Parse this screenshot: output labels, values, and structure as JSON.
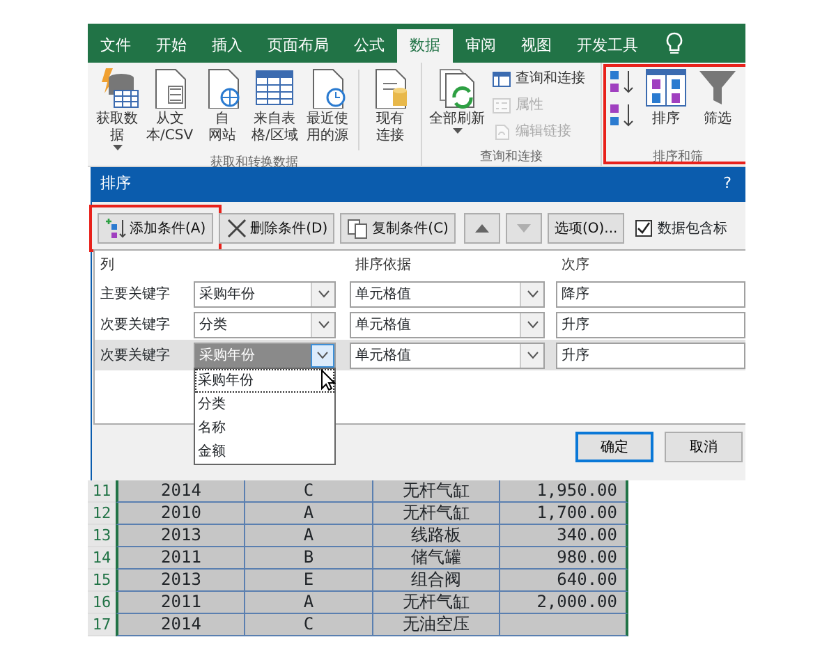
{
  "ribbon": {
    "tabs": [
      {
        "label": "文件",
        "selected": false
      },
      {
        "label": "开始",
        "selected": false
      },
      {
        "label": "插入",
        "selected": false
      },
      {
        "label": "页面布局",
        "selected": false
      },
      {
        "label": "公式",
        "selected": false
      },
      {
        "label": "数据",
        "selected": true
      },
      {
        "label": "审阅",
        "selected": false
      },
      {
        "label": "视图",
        "selected": false
      },
      {
        "label": "开发工具",
        "selected": false
      }
    ],
    "groups": [
      {
        "label": "获取和转换数据",
        "annotated": false,
        "buttons": [
          {
            "kind": "large",
            "lines": [
              "获取数",
              "据"
            ],
            "caret": true
          },
          {
            "kind": "large",
            "lines": [
              "从文",
              "本/CSV"
            ],
            "caret": false
          },
          {
            "kind": "large",
            "lines": [
              "自",
              "网站"
            ],
            "caret": false
          },
          {
            "kind": "large",
            "lines": [
              "来自表",
              "格/区域"
            ],
            "caret": false
          },
          {
            "kind": "large",
            "lines": [
              "最近使",
              "用的源"
            ],
            "caret": false
          },
          {
            "kind": "sep"
          },
          {
            "kind": "large",
            "lines": [
              "现有",
              "连接"
            ],
            "caret": false
          }
        ]
      },
      {
        "label": "查询和连接",
        "annotated": false,
        "buttons": [
          {
            "kind": "large",
            "lines": [
              "全部刷新"
            ],
            "caret": true
          },
          {
            "kind": "stack",
            "items": [
              {
                "label": "查询和连接",
                "disabled": false
              },
              {
                "label": "属性",
                "disabled": true
              },
              {
                "label": "编辑链接",
                "disabled": true
              }
            ]
          }
        ]
      },
      {
        "label": "排序和筛",
        "annotated": true,
        "buttons": [
          {
            "kind": "stack",
            "items": [
              {
                "disabled": false
              },
              {
                "disabled": false
              }
            ]
          },
          {
            "kind": "large",
            "lines": [
              "排序"
            ],
            "caret": false
          },
          {
            "kind": "large",
            "lines": [
              "筛选"
            ],
            "caret": false
          }
        ]
      }
    ]
  },
  "dialog": {
    "title": "排序",
    "help": "?",
    "toolbar": [
      {
        "kind": "add",
        "label": "添加条件(A)",
        "annotated": true,
        "disabled": false
      },
      {
        "kind": "delete",
        "label": "删除条件(D)",
        "annotated": false,
        "disabled": false
      },
      {
        "kind": "copy",
        "label": "复制条件(C)",
        "annotated": false,
        "disabled": false
      },
      {
        "kind": "up",
        "annotated": false,
        "disabled": false
      },
      {
        "kind": "down",
        "annotated": false,
        "disabled": true
      },
      {
        "kind": "text",
        "label": "选项(O)...",
        "annotated": false,
        "disabled": false
      }
    ],
    "header_checkbox": {
      "label": "数据包含标",
      "checked": true
    },
    "columns": [
      "列",
      "排序依据",
      "次序"
    ],
    "rows": [
      {
        "label": "主要关键字",
        "column": "采购年份",
        "sort_on": "单元格值",
        "order": "降序",
        "selected": false
      },
      {
        "label": "次要关键字",
        "column": "分类",
        "sort_on": "单元格值",
        "order": "升序",
        "selected": false
      },
      {
        "label": "次要关键字",
        "column": "采购年份",
        "sort_on": "单元格值",
        "order": "升序",
        "selected": true
      }
    ],
    "dropdown": {
      "items": [
        {
          "label": "采购年份",
          "focused": true
        },
        {
          "label": "分类",
          "focused": false
        },
        {
          "label": "名称",
          "focused": false
        },
        {
          "label": "金额",
          "focused": false
        }
      ]
    },
    "buttons": [
      {
        "label": "确定",
        "default": true
      },
      {
        "label": "取消",
        "default": false
      }
    ]
  },
  "sheet": {
    "rows": [
      {
        "number": "11",
        "cells": [
          "2014",
          "C",
          "无杆气缸",
          "1,950.00"
        ]
      },
      {
        "number": "12",
        "cells": [
          "2010",
          "A",
          "无杆气缸",
          "1,700.00"
        ]
      },
      {
        "number": "13",
        "cells": [
          "2013",
          "A",
          "线路板",
          "340.00"
        ]
      },
      {
        "number": "14",
        "cells": [
          "2011",
          "B",
          "储气罐",
          "980.00"
        ]
      },
      {
        "number": "15",
        "cells": [
          "2013",
          "E",
          "组合阀",
          "640.00"
        ]
      },
      {
        "number": "16",
        "cells": [
          "2011",
          "A",
          "无杆气缸",
          "2,000.00"
        ]
      },
      {
        "number": "17",
        "cells": [
          "2014",
          "C",
          "无油空压",
          ""
        ]
      }
    ]
  }
}
